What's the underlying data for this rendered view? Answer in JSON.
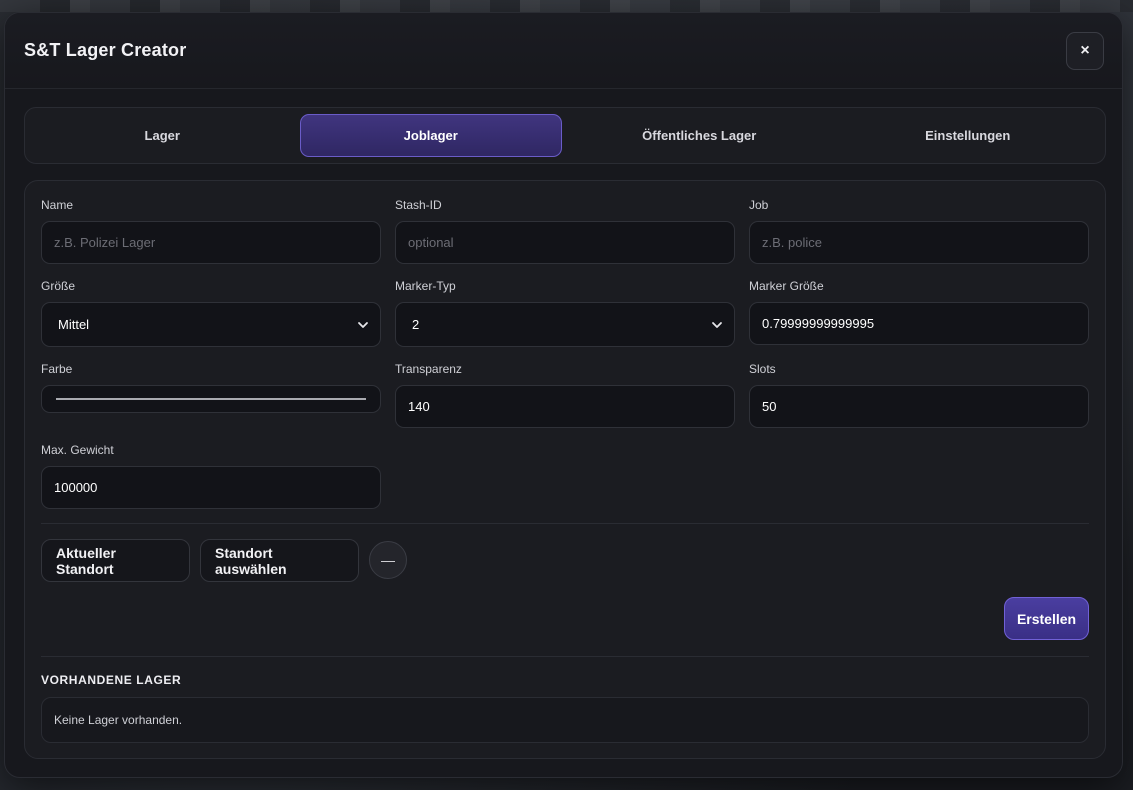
{
  "window": {
    "title": "S&T Lager Creator",
    "close_label": "×"
  },
  "tabs": [
    {
      "label": "Lager",
      "active": false
    },
    {
      "label": "Joblager",
      "active": true
    },
    {
      "label": "Öffentliches Lager",
      "active": false
    },
    {
      "label": "Einstellungen",
      "active": false
    }
  ],
  "form": {
    "name": {
      "label": "Name",
      "value": "",
      "placeholder": "z.B. Polizei Lager"
    },
    "stash_id": {
      "label": "Stash-ID",
      "value": "",
      "placeholder": "optional"
    },
    "job": {
      "label": "Job",
      "value": "",
      "placeholder": "z.B. police"
    },
    "size": {
      "label": "Größe",
      "value": "Mittel"
    },
    "marker_type": {
      "label": "Marker-Typ",
      "value": "2"
    },
    "marker_size": {
      "label": "Marker Größe",
      "value": "0.79999999999995"
    },
    "color": {
      "label": "Farbe",
      "value": "#a9aab0"
    },
    "transparency": {
      "label": "Transparenz",
      "value": "140"
    },
    "slots": {
      "label": "Slots",
      "value": "50"
    },
    "max_weight": {
      "label": "Max. Gewicht",
      "value": "100000"
    }
  },
  "actions": {
    "current_location": "Aktueller Standort",
    "select_location": "Standort auswählen",
    "location_status": "—",
    "create": "Erstellen"
  },
  "existing": {
    "title": "VORHANDENE LAGER",
    "empty_text": "Keine Lager vorhanden."
  },
  "colors": {
    "accent": "#3f3490",
    "accent_border": "#6a5cc8",
    "background": "#17181d"
  }
}
